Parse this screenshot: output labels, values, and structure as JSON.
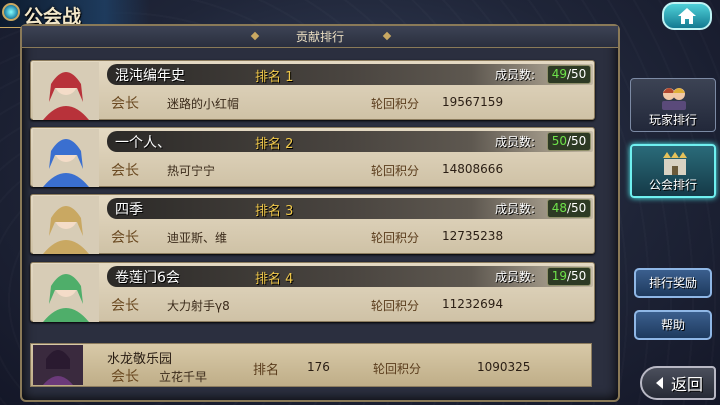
{
  "header": {
    "title": "公会战"
  },
  "panel": {
    "title": "贡献排行"
  },
  "labels": {
    "rank": "排名",
    "member_count": "成员数:",
    "leader": "会长",
    "score": "轮回积分"
  },
  "rows": [
    {
      "guild_name": "混沌编年史",
      "rank": "1",
      "members_current": "49",
      "members_max": "/50",
      "leader": "迷路的小红帽",
      "score": "19567159",
      "portrait_color": "#b8323a"
    },
    {
      "guild_name": "一个人、",
      "rank": "2",
      "members_current": "50",
      "members_max": "/50",
      "leader": "热可宁宁",
      "score": "14808666",
      "portrait_color": "#3a6fd0"
    },
    {
      "guild_name": "四季",
      "rank": "3",
      "members_current": "48",
      "members_max": "/50",
      "leader": "迪亚斯、维",
      "score": "12735238",
      "portrait_color": "#c9a862"
    },
    {
      "guild_name": "卷莲门6会",
      "rank": "4",
      "members_current": "19",
      "members_max": "/50",
      "leader": "大力射手γ8",
      "score": "11232694",
      "portrait_color": "#4fae6a"
    }
  ],
  "own_guild": {
    "name": "水龙敬乐园",
    "leader": "立花千早",
    "rank_label": "排名",
    "rank": "176",
    "score_label": "轮回积分",
    "score": "1090325",
    "portrait_color": "#6b3a7a"
  },
  "side": {
    "player_rank_label": "玩家排行",
    "guild_rank_label": "公会排行",
    "reward_label": "排行奖励",
    "help_label": "帮助",
    "back_label": "返回"
  },
  "colors": {
    "accent": "#6ff0f0",
    "gold": "#c9a862",
    "member_green": "#6ee24a"
  }
}
